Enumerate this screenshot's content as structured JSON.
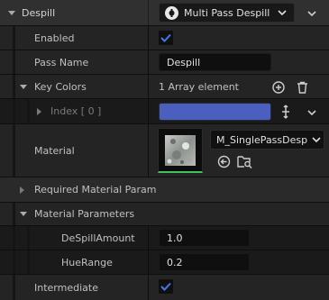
{
  "header": {
    "label": "Despill",
    "class_dropdown": "Multi Pass Despill"
  },
  "enabled": {
    "label": "Enabled",
    "checked": true
  },
  "pass_name": {
    "label": "Pass Name",
    "value": "Despill"
  },
  "key_colors": {
    "label": "Key Colors",
    "summary": "1 Array element",
    "index_label": "Index [ 0 ]",
    "color": "#4a5fbf"
  },
  "material": {
    "label": "Material",
    "asset": "M_SinglePassDesp"
  },
  "required_params": {
    "label": "Required Material Param"
  },
  "material_params": {
    "label": "Material Parameters",
    "items": [
      {
        "label": "DeSpillAmount",
        "value": "1.0"
      },
      {
        "label": "HueRange",
        "value": "0.2"
      }
    ]
  },
  "intermediate": {
    "label": "Intermediate",
    "checked": true
  },
  "colors": {
    "accent": "#3e7be8",
    "thumb_border": "#3fc35a"
  }
}
